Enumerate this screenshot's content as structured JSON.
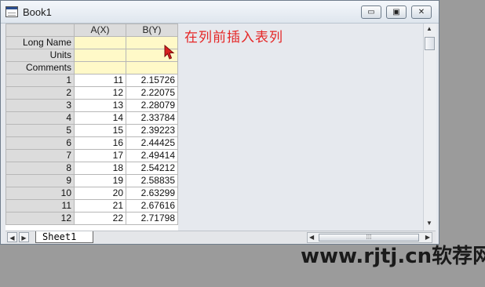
{
  "window": {
    "title": "Book1"
  },
  "window_buttons": {
    "minimize": "▭",
    "restore": "▣",
    "close": "✕"
  },
  "columns": [
    {
      "label": "A(X)"
    },
    {
      "label": "B(Y)"
    }
  ],
  "meta_rows": [
    {
      "label": "Long Name"
    },
    {
      "label": "Units"
    },
    {
      "label": "Comments"
    }
  ],
  "rows": [
    {
      "index": "1",
      "a": "11",
      "b": "2.15726"
    },
    {
      "index": "2",
      "a": "12",
      "b": "2.22075"
    },
    {
      "index": "3",
      "a": "13",
      "b": "2.28079"
    },
    {
      "index": "4",
      "a": "14",
      "b": "2.33784"
    },
    {
      "index": "5",
      "a": "15",
      "b": "2.39223"
    },
    {
      "index": "6",
      "a": "16",
      "b": "2.44425"
    },
    {
      "index": "7",
      "a": "17",
      "b": "2.49414"
    },
    {
      "index": "8",
      "a": "18",
      "b": "2.54212"
    },
    {
      "index": "9",
      "a": "19",
      "b": "2.58835"
    },
    {
      "index": "10",
      "a": "20",
      "b": "2.63299"
    },
    {
      "index": "11",
      "a": "21",
      "b": "2.67616"
    },
    {
      "index": "12",
      "a": "22",
      "b": "2.71798"
    }
  ],
  "annotation": "在列前插入表列",
  "sheet_tab": "Sheet1",
  "watermark": "www.rjtj.cn软荐网",
  "colors": {
    "annotation": "#e52626",
    "meta_cell": "#fff9c8",
    "desktop": "#9b9b9b"
  },
  "icons": [
    "app-book-icon",
    "cursor-arrow-icon",
    "scroll-up-icon",
    "scroll-down-icon",
    "nav-left-icon",
    "nav-right-icon",
    "scroll-left-icon",
    "scroll-right-icon"
  ]
}
